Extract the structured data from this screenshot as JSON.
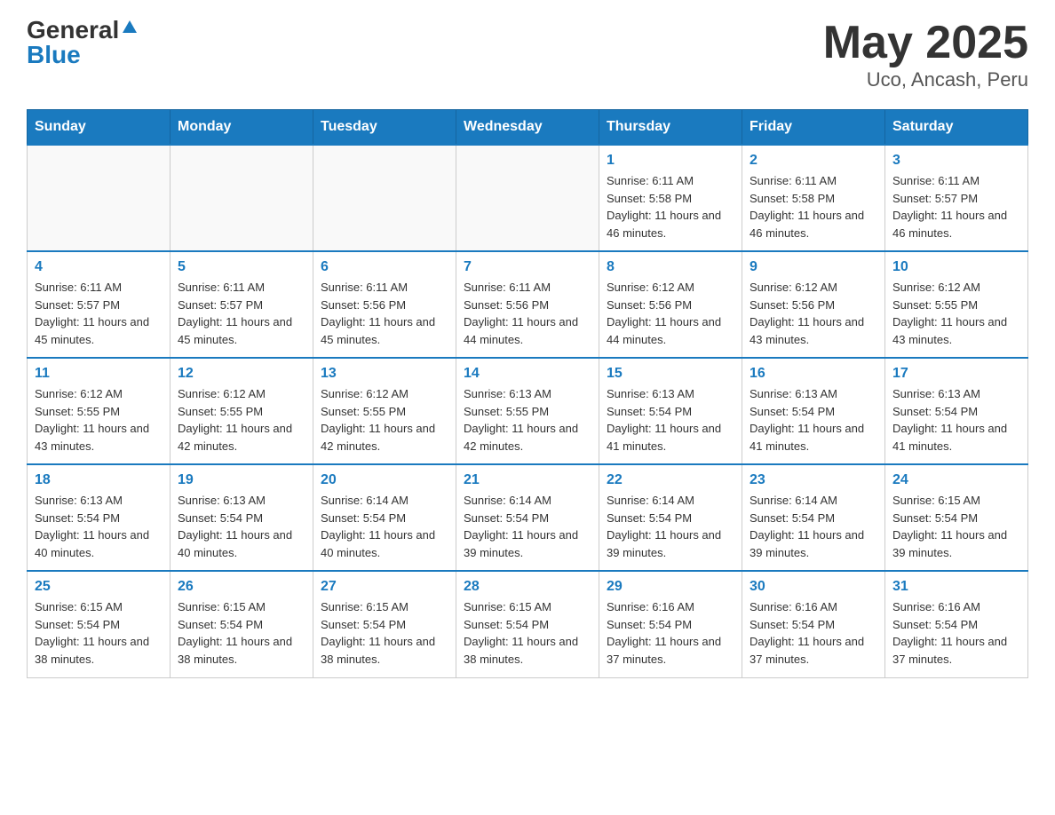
{
  "header": {
    "logo_general": "General",
    "logo_blue": "Blue",
    "month_title": "May 2025",
    "location": "Uco, Ancash, Peru"
  },
  "days_of_week": [
    "Sunday",
    "Monday",
    "Tuesday",
    "Wednesday",
    "Thursday",
    "Friday",
    "Saturday"
  ],
  "weeks": [
    [
      {
        "day": "",
        "info": ""
      },
      {
        "day": "",
        "info": ""
      },
      {
        "day": "",
        "info": ""
      },
      {
        "day": "",
        "info": ""
      },
      {
        "day": "1",
        "info": "Sunrise: 6:11 AM\nSunset: 5:58 PM\nDaylight: 11 hours and 46 minutes."
      },
      {
        "day": "2",
        "info": "Sunrise: 6:11 AM\nSunset: 5:58 PM\nDaylight: 11 hours and 46 minutes."
      },
      {
        "day": "3",
        "info": "Sunrise: 6:11 AM\nSunset: 5:57 PM\nDaylight: 11 hours and 46 minutes."
      }
    ],
    [
      {
        "day": "4",
        "info": "Sunrise: 6:11 AM\nSunset: 5:57 PM\nDaylight: 11 hours and 45 minutes."
      },
      {
        "day": "5",
        "info": "Sunrise: 6:11 AM\nSunset: 5:57 PM\nDaylight: 11 hours and 45 minutes."
      },
      {
        "day": "6",
        "info": "Sunrise: 6:11 AM\nSunset: 5:56 PM\nDaylight: 11 hours and 45 minutes."
      },
      {
        "day": "7",
        "info": "Sunrise: 6:11 AM\nSunset: 5:56 PM\nDaylight: 11 hours and 44 minutes."
      },
      {
        "day": "8",
        "info": "Sunrise: 6:12 AM\nSunset: 5:56 PM\nDaylight: 11 hours and 44 minutes."
      },
      {
        "day": "9",
        "info": "Sunrise: 6:12 AM\nSunset: 5:56 PM\nDaylight: 11 hours and 43 minutes."
      },
      {
        "day": "10",
        "info": "Sunrise: 6:12 AM\nSunset: 5:55 PM\nDaylight: 11 hours and 43 minutes."
      }
    ],
    [
      {
        "day": "11",
        "info": "Sunrise: 6:12 AM\nSunset: 5:55 PM\nDaylight: 11 hours and 43 minutes."
      },
      {
        "day": "12",
        "info": "Sunrise: 6:12 AM\nSunset: 5:55 PM\nDaylight: 11 hours and 42 minutes."
      },
      {
        "day": "13",
        "info": "Sunrise: 6:12 AM\nSunset: 5:55 PM\nDaylight: 11 hours and 42 minutes."
      },
      {
        "day": "14",
        "info": "Sunrise: 6:13 AM\nSunset: 5:55 PM\nDaylight: 11 hours and 42 minutes."
      },
      {
        "day": "15",
        "info": "Sunrise: 6:13 AM\nSunset: 5:54 PM\nDaylight: 11 hours and 41 minutes."
      },
      {
        "day": "16",
        "info": "Sunrise: 6:13 AM\nSunset: 5:54 PM\nDaylight: 11 hours and 41 minutes."
      },
      {
        "day": "17",
        "info": "Sunrise: 6:13 AM\nSunset: 5:54 PM\nDaylight: 11 hours and 41 minutes."
      }
    ],
    [
      {
        "day": "18",
        "info": "Sunrise: 6:13 AM\nSunset: 5:54 PM\nDaylight: 11 hours and 40 minutes."
      },
      {
        "day": "19",
        "info": "Sunrise: 6:13 AM\nSunset: 5:54 PM\nDaylight: 11 hours and 40 minutes."
      },
      {
        "day": "20",
        "info": "Sunrise: 6:14 AM\nSunset: 5:54 PM\nDaylight: 11 hours and 40 minutes."
      },
      {
        "day": "21",
        "info": "Sunrise: 6:14 AM\nSunset: 5:54 PM\nDaylight: 11 hours and 39 minutes."
      },
      {
        "day": "22",
        "info": "Sunrise: 6:14 AM\nSunset: 5:54 PM\nDaylight: 11 hours and 39 minutes."
      },
      {
        "day": "23",
        "info": "Sunrise: 6:14 AM\nSunset: 5:54 PM\nDaylight: 11 hours and 39 minutes."
      },
      {
        "day": "24",
        "info": "Sunrise: 6:15 AM\nSunset: 5:54 PM\nDaylight: 11 hours and 39 minutes."
      }
    ],
    [
      {
        "day": "25",
        "info": "Sunrise: 6:15 AM\nSunset: 5:54 PM\nDaylight: 11 hours and 38 minutes."
      },
      {
        "day": "26",
        "info": "Sunrise: 6:15 AM\nSunset: 5:54 PM\nDaylight: 11 hours and 38 minutes."
      },
      {
        "day": "27",
        "info": "Sunrise: 6:15 AM\nSunset: 5:54 PM\nDaylight: 11 hours and 38 minutes."
      },
      {
        "day": "28",
        "info": "Sunrise: 6:15 AM\nSunset: 5:54 PM\nDaylight: 11 hours and 38 minutes."
      },
      {
        "day": "29",
        "info": "Sunrise: 6:16 AM\nSunset: 5:54 PM\nDaylight: 11 hours and 37 minutes."
      },
      {
        "day": "30",
        "info": "Sunrise: 6:16 AM\nSunset: 5:54 PM\nDaylight: 11 hours and 37 minutes."
      },
      {
        "day": "31",
        "info": "Sunrise: 6:16 AM\nSunset: 5:54 PM\nDaylight: 11 hours and 37 minutes."
      }
    ]
  ]
}
